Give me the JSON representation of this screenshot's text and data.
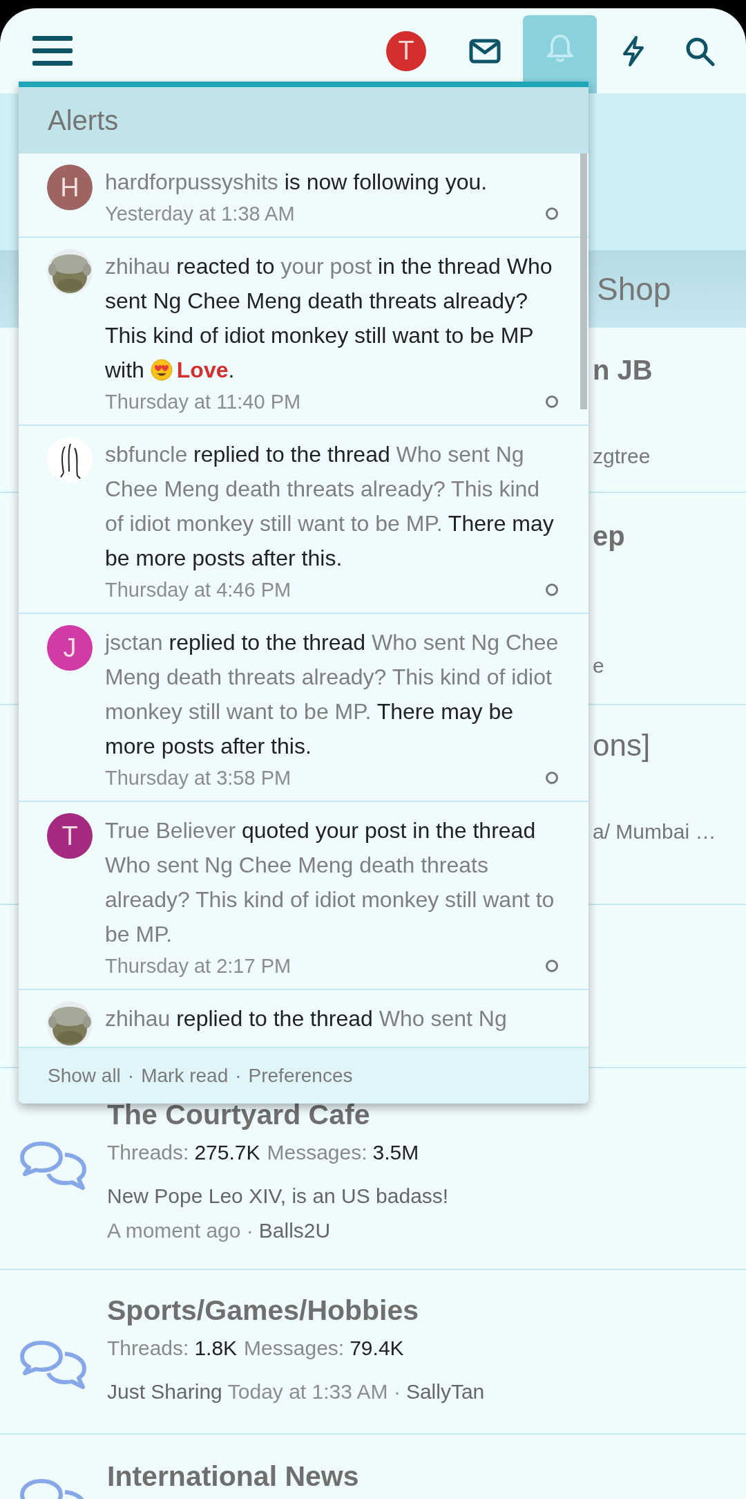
{
  "header": {
    "avatar": {
      "letter": "T",
      "color": "#d32f2f"
    },
    "icons": [
      {
        "kind": "mail",
        "selected": false
      },
      {
        "kind": "bell",
        "selected": true
      },
      {
        "kind": "bolt",
        "selected": false
      },
      {
        "kind": "search",
        "selected": false
      }
    ]
  },
  "band": {
    "title": "Shop"
  },
  "rows": [
    {
      "title": "n JB",
      "bold": true,
      "meta": "zgtree"
    },
    {
      "title": "ep",
      "bold": true,
      "meta": "e"
    },
    {
      "title": "ons]",
      "bold": false,
      "meta": "a/ Mumbai …"
    }
  ],
  "forums": [
    {
      "title": "The Courtyard Cafe",
      "stats": [
        {
          "label": "Threads:",
          "value": "275.7K"
        },
        {
          "label": "Messages:",
          "value": "3.5M"
        }
      ],
      "latest": [
        {
          "text": "New Pope Leo XIV, is an US badass!",
          "kind": "link"
        },
        {
          "text": "A moment ago ·",
          "kind": "time"
        },
        {
          "text": "Balls2U",
          "kind": "link"
        }
      ]
    },
    {
      "title": "Sports/Games/Hobbies",
      "stats": [
        {
          "label": "Threads:",
          "value": "1.8K"
        },
        {
          "label": "Messages:",
          "value": "79.4K"
        }
      ],
      "latest": [
        {
          "text": "Just Sharing",
          "kind": "link"
        },
        {
          "text": "Today at 1:33 AM ·",
          "kind": "time"
        },
        {
          "text": "SallyTan",
          "kind": "link"
        }
      ]
    },
    {
      "title": "International News"
    }
  ],
  "alerts": {
    "title": "Alerts",
    "items": [
      {
        "avatar": {
          "kind": "letter",
          "letter": "H",
          "color": "#9e6462"
        },
        "parts": [
          {
            "kind": "user",
            "text": "hardforpussyshits"
          },
          {
            "kind": "plain",
            "text": " is now following you."
          }
        ],
        "time": "Yesterday at 1:38 AM",
        "read": false
      },
      {
        "avatar": {
          "kind": "picture"
        },
        "parts": [
          {
            "kind": "user",
            "text": "zhihau"
          },
          {
            "kind": "plain",
            "text": " reacted to "
          },
          {
            "kind": "link",
            "text": "your post"
          },
          {
            "kind": "plain",
            "text": " in the thread Who sent Ng Chee Meng death threats already? This kind of idiot monkey still want to be MP with "
          },
          {
            "kind": "emoji"
          },
          {
            "kind": "reaction",
            "text": "Love"
          },
          {
            "kind": "plain",
            "text": "."
          }
        ],
        "time": "Thursday at 11:40 PM",
        "read": false
      },
      {
        "avatar": {
          "kind": "sketch"
        },
        "parts": [
          {
            "kind": "user",
            "text": "sbfuncle"
          },
          {
            "kind": "plain",
            "text": " replied to the thread "
          },
          {
            "kind": "link",
            "text": "Who sent Ng Chee Meng death threats already? This kind of idiot monkey still want to be MP."
          },
          {
            "kind": "plain",
            "text": " There may be more posts after this."
          }
        ],
        "time": "Thursday at 4:46 PM",
        "read": false
      },
      {
        "avatar": {
          "kind": "letter",
          "letter": "J",
          "color": "#d03ba6"
        },
        "parts": [
          {
            "kind": "user",
            "text": "jsctan"
          },
          {
            "kind": "plain",
            "text": " replied to the thread "
          },
          {
            "kind": "link",
            "text": "Who sent Ng Chee Meng death threats already? This kind of idiot monkey still want to be MP."
          },
          {
            "kind": "plain",
            "text": " There may be more posts after this."
          }
        ],
        "time": "Thursday at 3:58 PM",
        "read": false
      },
      {
        "avatar": {
          "kind": "letter",
          "letter": "T",
          "color": "#a62a82"
        },
        "parts": [
          {
            "kind": "user",
            "text": "True Believer"
          },
          {
            "kind": "plain",
            "text": " quoted your post in the thread "
          },
          {
            "kind": "link",
            "text": "Who sent Ng Chee Meng death threats already? This kind of idiot monkey still want to be MP."
          }
        ],
        "time": "Thursday at 2:17 PM",
        "read": false
      },
      {
        "avatar": {
          "kind": "picture"
        },
        "parts": [
          {
            "kind": "user",
            "text": "zhihau"
          },
          {
            "kind": "plain",
            "text": " replied to the thread "
          },
          {
            "kind": "link",
            "text": "Who sent Ng"
          }
        ]
      }
    ],
    "footer": {
      "links": [
        "Show all",
        "Mark read",
        "Preferences"
      ],
      "separator": "·"
    }
  }
}
